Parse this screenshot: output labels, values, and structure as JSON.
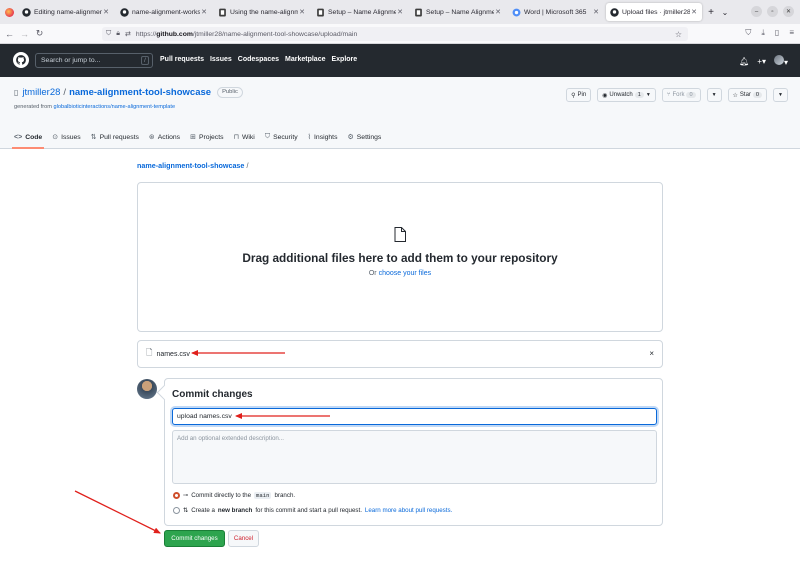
{
  "browser": {
    "tabs": [
      {
        "title": "Editing name-alignment-w",
        "favicon": "github-icon",
        "active": false
      },
      {
        "title": "name-alignment-worksho",
        "favicon": "github-icon",
        "active": false
      },
      {
        "title": "Using the name-alignmer",
        "favicon": "page-icon",
        "active": false
      },
      {
        "title": "Setup – Name Alignment",
        "favicon": "page-icon",
        "active": false
      },
      {
        "title": "Setup – Name Alignmer",
        "favicon": "page-icon",
        "active": false
      },
      {
        "title": "Word | Microsoft 365",
        "favicon": "office-icon",
        "active": false
      },
      {
        "title": "Upload files · jtmiller28/",
        "favicon": "github-icon",
        "active": true
      }
    ],
    "url_prefix": "https://",
    "url_host": "github.com",
    "url_path": "/jtmiller28/name-alignment-tool-showcase/upload/main"
  },
  "github_header": {
    "search_placeholder": "Search or jump to...",
    "search_key": "/",
    "nav": [
      "Pull requests",
      "Issues",
      "Codespaces",
      "Marketplace",
      "Explore"
    ]
  },
  "repo": {
    "owner": "jtmiller28",
    "separator": "/",
    "name": "name-alignment-tool-showcase",
    "visibility": "Public",
    "generated_from_label": "generated from",
    "generated_from_link": "globalbioticinteractions/name-alignment-template",
    "pin_label": "Pin",
    "unwatch_label": "Unwatch",
    "unwatch_count": "1",
    "fork_label": "Fork",
    "fork_count": "0",
    "star_label": "Star",
    "star_count": "0",
    "tabs": [
      {
        "label": "Code",
        "icon": "code-icon",
        "selected": true
      },
      {
        "label": "Issues",
        "icon": "issue-icon",
        "selected": false
      },
      {
        "label": "Pull requests",
        "icon": "pull-request-icon",
        "selected": false
      },
      {
        "label": "Actions",
        "icon": "play-icon",
        "selected": false
      },
      {
        "label": "Projects",
        "icon": "table-icon",
        "selected": false
      },
      {
        "label": "Wiki",
        "icon": "book-icon",
        "selected": false
      },
      {
        "label": "Security",
        "icon": "shield-icon",
        "selected": false
      },
      {
        "label": "Insights",
        "icon": "graph-icon",
        "selected": false
      },
      {
        "label": "Settings",
        "icon": "gear-icon",
        "selected": false
      }
    ]
  },
  "upload": {
    "breadcrumb_repo": "name-alignment-tool-showcase",
    "breadcrumb_sep": "/",
    "drop_title": "Drag additional files here to add them to your repository",
    "drop_or": "Or",
    "drop_link": "choose your files",
    "file_name": "names.csv",
    "remove_symbol": "×"
  },
  "commit": {
    "title": "Commit changes",
    "summary_value": "upload names.csv",
    "description_placeholder": "Add an optional extended description...",
    "option1_pre": "Commit directly to the",
    "option1_branch": "main",
    "option1_post": "branch.",
    "option2_pre": "Create a",
    "option2_bold": "new branch",
    "option2_mid": "for this commit and start a pull request.",
    "option2_link": "Learn more about pull requests.",
    "selected_option": 1,
    "commit_button": "Commit changes",
    "cancel_button": "Cancel"
  },
  "colors": {
    "annotation_arrow": "#e0201c",
    "primary_button": "#2da44e",
    "link": "#0969da",
    "header_bg": "#24292f"
  }
}
